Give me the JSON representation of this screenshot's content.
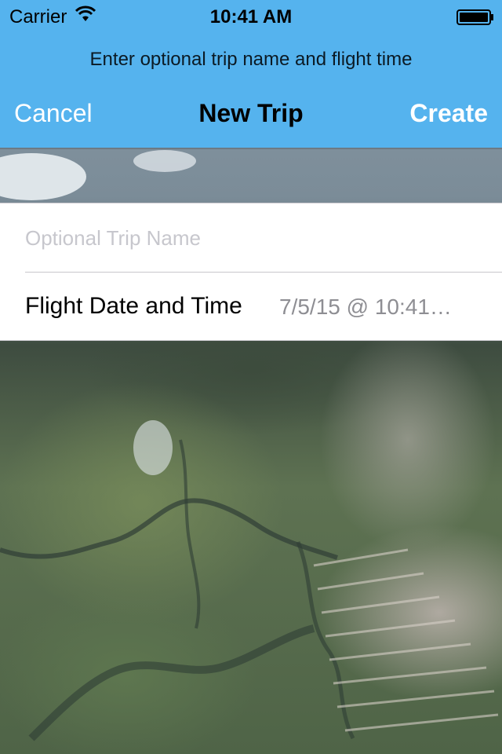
{
  "status_bar": {
    "carrier": "Carrier",
    "time": "10:41 AM",
    "wifi_icon": "wifi-icon",
    "battery_icon": "battery-icon"
  },
  "header": {
    "prompt": "Enter optional trip name and flight time",
    "cancel_label": "Cancel",
    "title": "New Trip",
    "create_label": "Create",
    "background_color": "#55b3ee"
  },
  "form": {
    "trip_name": {
      "value": "",
      "placeholder": "Optional Trip Name"
    },
    "flight_date": {
      "label": "Flight Date and Time",
      "value": "7/5/15 @ 10:41…"
    }
  },
  "background": {
    "image": "aerial-landscape-photo"
  }
}
